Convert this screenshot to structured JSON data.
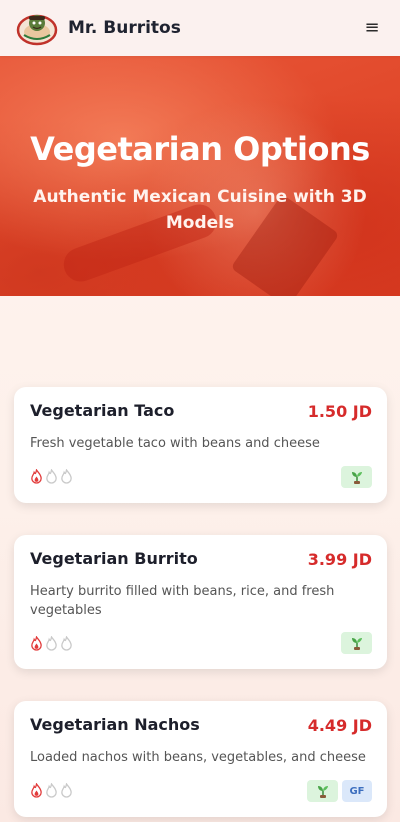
{
  "header": {
    "brand": "Mr. Burritos",
    "menu_icon": "hamburger-menu-icon",
    "menu_glyph": "≡"
  },
  "hero": {
    "title": "Vegetarian Options",
    "subtitle": "Authentic Mexican Cuisine with 3D Models"
  },
  "colors": {
    "accent": "#d62b2b",
    "hero_red": "#e24a2c",
    "veg_tag_bg": "#dcf4dd",
    "gf_tag_bg": "#dbe8fa"
  },
  "menu_items": [
    {
      "name": "Vegetarian Taco",
      "price": "1.50 JD",
      "description": "Fresh vegetable taco with beans and cheese",
      "spice_level": 1,
      "spice_max": 3,
      "tags": [
        "vegetarian"
      ]
    },
    {
      "name": "Vegetarian Burrito",
      "price": "3.99 JD",
      "description": "Hearty burrito filled with beans, rice, and fresh vegetables",
      "spice_level": 1,
      "spice_max": 3,
      "tags": [
        "vegetarian"
      ]
    },
    {
      "name": "Vegetarian Nachos",
      "price": "4.49 JD",
      "description": "Loaded nachos with beans, vegetables, and cheese",
      "spice_level": 1,
      "spice_max": 3,
      "tags": [
        "vegetarian",
        "GF"
      ]
    }
  ]
}
